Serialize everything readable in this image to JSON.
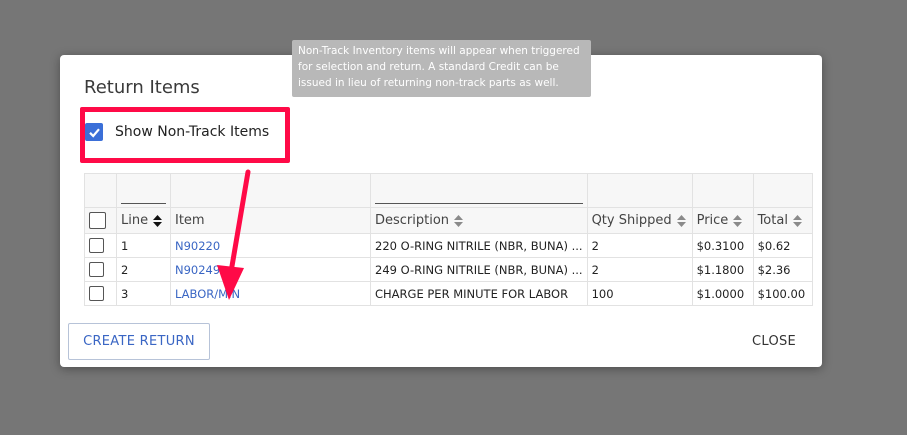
{
  "modal": {
    "title": "Return Items",
    "tooltip": "Non-Track Inventory items will appear when triggered for selection and return. A standard Credit can be issued in lieu of returning non-track parts as well.",
    "show_non_track": {
      "label": "Show Non-Track Items",
      "checked": true
    },
    "table": {
      "columns": [
        "Line",
        "Item",
        "Description",
        "Qty Shipped",
        "Price",
        "Total"
      ],
      "rows": [
        {
          "line": "1",
          "item": "N90220",
          "description": "220 O-RING NITRILE (NBR, BUNA) ...",
          "qty_shipped": "2",
          "price": "$0.3100",
          "total": "$0.62"
        },
        {
          "line": "2",
          "item": "N90249",
          "description": "249 O-RING NITRILE (NBR, BUNA) ...",
          "qty_shipped": "2",
          "price": "$1.1800",
          "total": "$2.36"
        },
        {
          "line": "3",
          "item": "LABOR/MIN",
          "description": "CHARGE PER MINUTE FOR LABOR",
          "qty_shipped": "100",
          "price": "$1.0000",
          "total": "$100.00"
        }
      ]
    },
    "buttons": {
      "create_return": "CREATE RETURN",
      "close": "CLOSE"
    }
  },
  "colors": {
    "accent": "#3a66c4",
    "checkbox": "#3b6fd8",
    "annotation": "#ff0a47",
    "overlay": "#767676"
  },
  "icons": {
    "checkbox_check": "check-icon",
    "sort": "sort-icon",
    "annotation_arrow": "arrow-down-icon"
  }
}
